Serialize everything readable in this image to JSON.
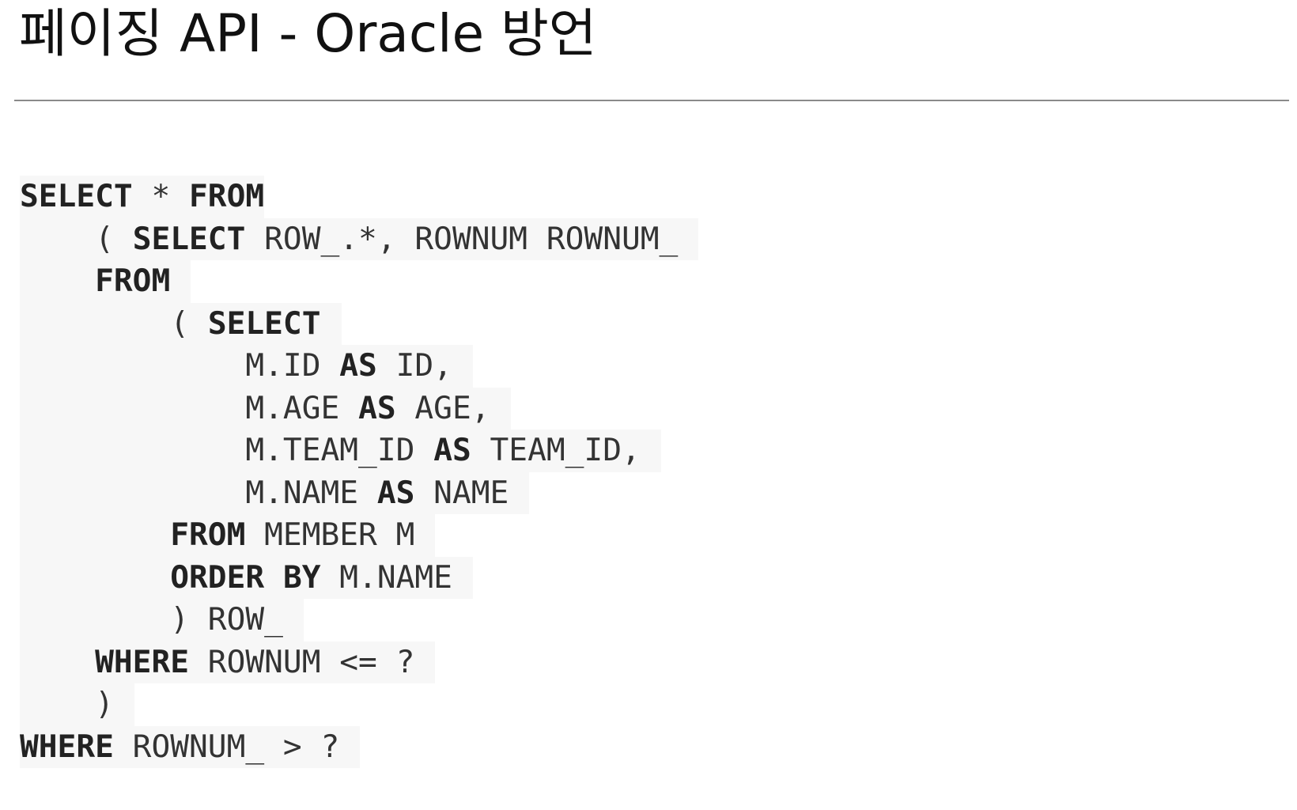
{
  "title": "페이징 API - Oracle 방언",
  "code_lines": [
    [
      {
        "t": "SELECT",
        "k": 1
      },
      {
        "t": " * ",
        "k": 0
      },
      {
        "t": "FROM",
        "k": 1
      }
    ],
    [
      {
        "t": "    ( ",
        "k": 0
      },
      {
        "t": "SELECT",
        "k": 1
      },
      {
        "t": " ROW_.*, ROWNUM ROWNUM_",
        "k": 0
      }
    ],
    [
      {
        "t": "    ",
        "k": 0
      },
      {
        "t": "FROM",
        "k": 1
      }
    ],
    [
      {
        "t": "        ( ",
        "k": 0
      },
      {
        "t": "SELECT",
        "k": 1
      }
    ],
    [
      {
        "t": "            M.ID ",
        "k": 0
      },
      {
        "t": "AS",
        "k": 1
      },
      {
        "t": " ID,",
        "k": 0
      }
    ],
    [
      {
        "t": "            M.AGE ",
        "k": 0
      },
      {
        "t": "AS",
        "k": 1
      },
      {
        "t": " AGE,",
        "k": 0
      }
    ],
    [
      {
        "t": "            M.TEAM_ID ",
        "k": 0
      },
      {
        "t": "AS",
        "k": 1
      },
      {
        "t": " TEAM_ID,",
        "k": 0
      }
    ],
    [
      {
        "t": "            M.NAME ",
        "k": 0
      },
      {
        "t": "AS",
        "k": 1
      },
      {
        "t": " NAME",
        "k": 0
      }
    ],
    [
      {
        "t": "        ",
        "k": 0
      },
      {
        "t": "FROM",
        "k": 1
      },
      {
        "t": " MEMBER M",
        "k": 0
      }
    ],
    [
      {
        "t": "        ",
        "k": 0
      },
      {
        "t": "ORDER",
        "k": 1
      },
      {
        "t": " ",
        "k": 0
      },
      {
        "t": "BY",
        "k": 1
      },
      {
        "t": " M.NAME",
        "k": 0
      }
    ],
    [
      {
        "t": "        ) ROW_",
        "k": 0
      }
    ],
    [
      {
        "t": "    ",
        "k": 0
      },
      {
        "t": "WHERE",
        "k": 1
      },
      {
        "t": " ROWNUM <= ?",
        "k": 0
      }
    ],
    [
      {
        "t": "    )",
        "k": 0
      }
    ],
    [
      {
        "t": "WHERE",
        "k": 1
      },
      {
        "t": " ROWNUM_ > ?",
        "k": 0
      }
    ]
  ]
}
